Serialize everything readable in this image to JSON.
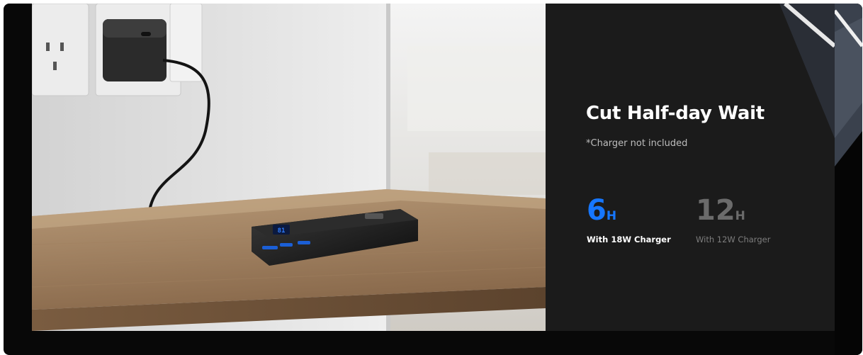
{
  "banner": {
    "headline": "Cut Half-day Wait",
    "note": "*Charger not included",
    "stats": [
      {
        "value": "6",
        "unit": "H",
        "label": "With 18W Charger",
        "color": "#1677ff"
      },
      {
        "value": "12",
        "unit": "H",
        "label": "With 12W Charger",
        "color": "#6b6b6b"
      }
    ]
  },
  "photo": {
    "subject": "power-bank-charging-photo",
    "device_display": "81"
  },
  "colors": {
    "panel_bg": "#1b1b1b",
    "frame_bg": "#080808",
    "accent": "#1677ff"
  }
}
